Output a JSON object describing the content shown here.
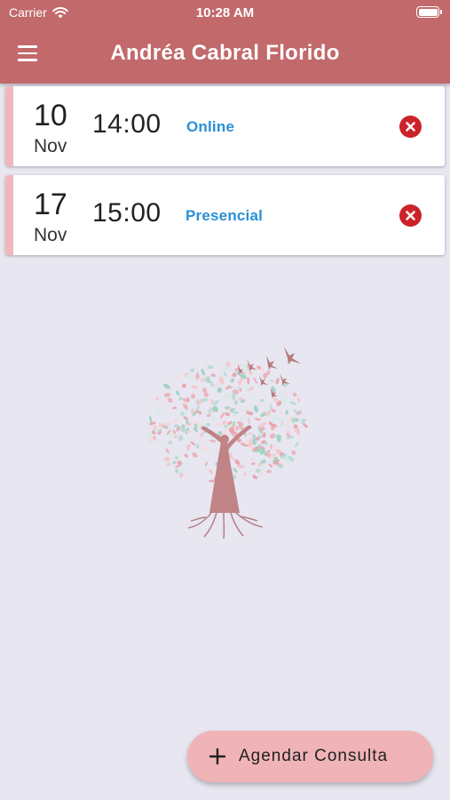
{
  "status_bar": {
    "carrier": "Carrier",
    "time": "10:28 AM"
  },
  "header": {
    "title": "Andréa Cabral Florido"
  },
  "appointments": [
    {
      "day": "10",
      "month": "Nov",
      "time": "14:00",
      "mode": "Online"
    },
    {
      "day": "17",
      "month": "Nov",
      "time": "15:00",
      "mode": "Presencial"
    }
  ],
  "fab": {
    "label": "Agendar Consulta"
  },
  "colors": {
    "header": "#c2696b",
    "background": "#e7e6f1",
    "accent_pink": "#f1b7bc",
    "mode_text": "#2a8fd6",
    "cancel": "#cc2229"
  },
  "icons": [
    "wifi-icon",
    "battery-icon",
    "menu-icon",
    "cancel-icon",
    "plus-icon",
    "tree-logo"
  ]
}
